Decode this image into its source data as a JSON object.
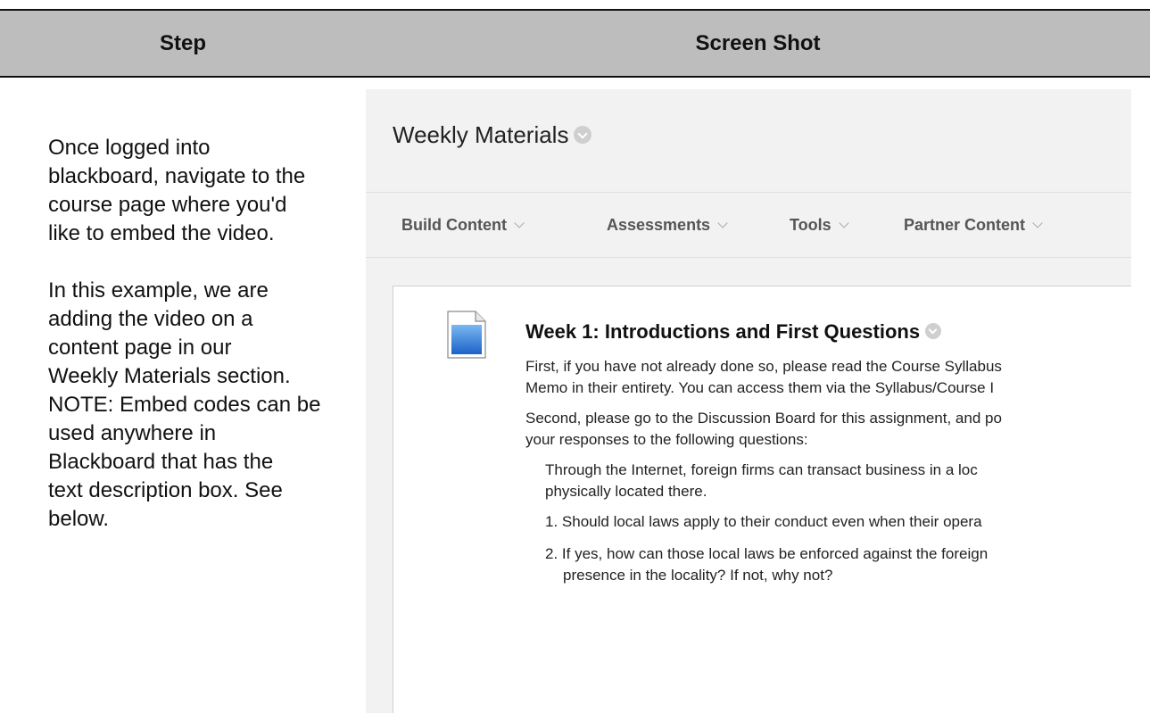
{
  "table": {
    "header_step": "Step",
    "header_screenshot": "Screen Shot"
  },
  "step": {
    "paragraph1_lines": [
      "Once logged into",
      "blackboard, navigate to the",
      "course page where you'd",
      "like to embed the video."
    ],
    "paragraph2_lines": [
      "In this example, we are",
      "adding the video on a",
      "content page in our",
      "Weekly Materials section.",
      "NOTE: Embed codes can be",
      "used anywhere in",
      "Blackboard that has the",
      "text description box. See",
      "below."
    ]
  },
  "screenshot": {
    "page_title": "Weekly Materials",
    "menu": [
      {
        "label": "Build Content"
      },
      {
        "label": "Assessments"
      },
      {
        "label": "Tools"
      },
      {
        "label": "Partner Content"
      }
    ],
    "item": {
      "icon": "document-icon",
      "title": "Week 1: Introductions and First Questions",
      "para1_line1": "First, if you have not already done so, please read the Course Syllabus",
      "para1_line2": "Memo in their entirety. You can access them via the Syllabus/Course I",
      "para2_line1": "Second, please go to the Discussion Board for this assignment, and po",
      "para2_line2": "your responses to the following questions:",
      "quote_line1": "Through the Internet, foreign firms can transact business in a loc",
      "quote_line2": "physically located there.",
      "list": [
        {
          "num": "1.",
          "line1": "Should local laws apply to their conduct even when their opera",
          "line2": ""
        },
        {
          "num": "2.",
          "line1": "If yes, how can those local laws be enforced against the foreign",
          "line2": "presence in the locality? If not, why not?"
        }
      ]
    }
  }
}
